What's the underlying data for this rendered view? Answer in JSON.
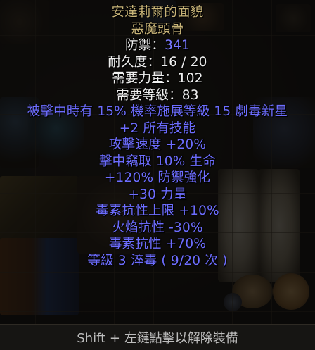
{
  "item": {
    "name": "安達莉爾的面貌",
    "base_type": "惡魔頭骨",
    "defense_label": "防禦：",
    "defense_value": "341",
    "durability": "耐久度：16 / 20",
    "req_strength": "需要力量：102",
    "req_level": "需要等級：83",
    "mods": [
      "被擊中時有 15% 機率施展等級 15 劇毒新星",
      "+2 所有技能",
      "攻擊速度 +20%",
      "擊中竊取 10% 生命",
      "+120% 防禦強化",
      "+30 力量",
      "毒素抗性上限 +10%",
      "火焰抗性 -30%",
      "毒素抗性 +70%",
      "等級 3 淬毒 ( 9/20 次 )"
    ]
  },
  "hint": "Shift + 左鍵點擊以解除裝備",
  "colors": {
    "unique": "#c7b377",
    "magic": "#6d6dff",
    "normal": "#f0f0f0"
  }
}
